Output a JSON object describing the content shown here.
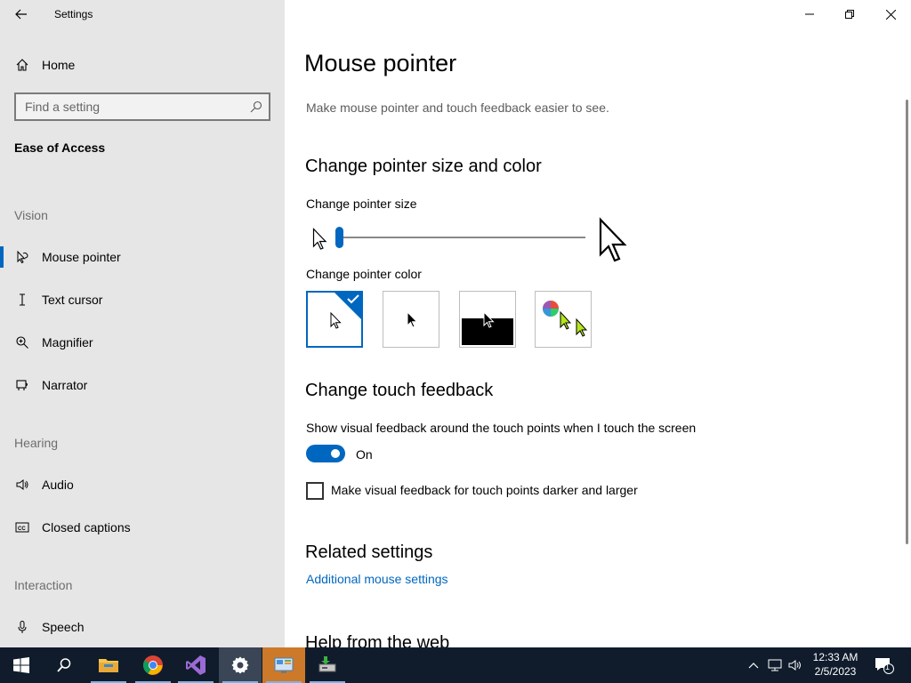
{
  "window": {
    "app_title": "Settings"
  },
  "sidebar": {
    "home_label": "Home",
    "search": {
      "placeholder": "Find a setting",
      "value": ""
    },
    "category": "Ease of Access",
    "groups": [
      {
        "header": "Vision",
        "items": [
          {
            "label": "Mouse pointer",
            "icon": "mouse-pointer-icon",
            "selected": true
          },
          {
            "label": "Text cursor",
            "icon": "text-cursor-icon"
          },
          {
            "label": "Magnifier",
            "icon": "magnifier-icon"
          },
          {
            "label": "Narrator",
            "icon": "narrator-icon"
          }
        ]
      },
      {
        "header": "Hearing",
        "items": [
          {
            "label": "Audio",
            "icon": "speaker-icon"
          },
          {
            "label": "Closed captions",
            "icon": "closed-captions-icon"
          }
        ]
      },
      {
        "header": "Interaction",
        "items": [
          {
            "label": "Speech",
            "icon": "microphone-icon"
          }
        ]
      }
    ]
  },
  "main": {
    "title": "Mouse pointer",
    "description": "Make mouse pointer and touch feedback easier to see.",
    "size_color_section": {
      "header": "Change pointer size and color",
      "size_label": "Change pointer size",
      "size_slider_value": 1,
      "color_label": "Change pointer color",
      "color_options": [
        {
          "name": "white",
          "selected": true
        },
        {
          "name": "black",
          "selected": false
        },
        {
          "name": "inverted",
          "selected": false
        },
        {
          "name": "custom",
          "selected": false
        }
      ]
    },
    "touch_section": {
      "header": "Change touch feedback",
      "toggle_label": "Show visual feedback around the touch points when I touch the screen",
      "toggle_state": "On",
      "checkbox_label": "Make visual feedback for touch points darker and larger",
      "checkbox_checked": false
    },
    "related": {
      "header": "Related settings",
      "link": "Additional mouse settings"
    },
    "help_header": "Help from the web"
  },
  "taskbar": {
    "apps": [
      "start-icon",
      "search-icon",
      "file-explorer-icon",
      "chrome-icon",
      "visual-studio-icon",
      "settings-icon",
      "control-panel-icon",
      "setup-icon"
    ],
    "clock": {
      "time": "12:33 AM",
      "date": "2/5/2023"
    },
    "notification_count": "1"
  },
  "colors": {
    "accent": "#0067c0",
    "sidebar_bg": "#e6e6e6",
    "taskbar_bg": "#101c2c"
  }
}
